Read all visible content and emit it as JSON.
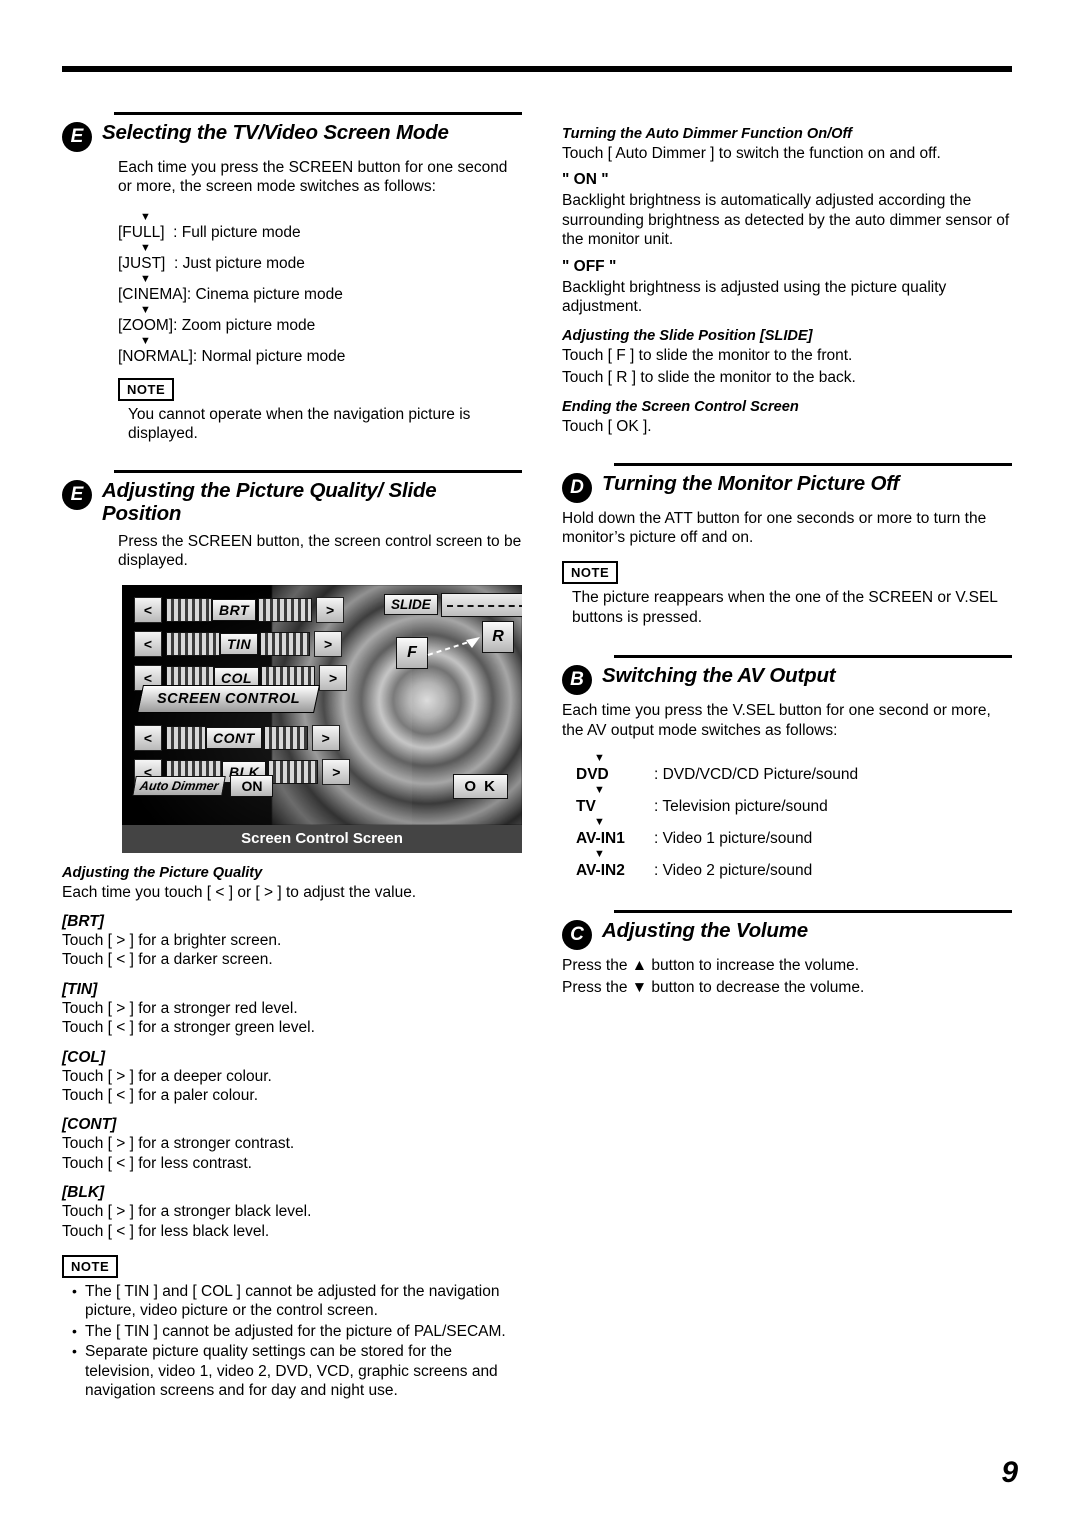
{
  "page": {
    "number": "9"
  },
  "left": {
    "sec_e1": {
      "badge": "E",
      "title": "Selecting the TV/Video Screen Mode",
      "body": "Each time you press the SCREEN button for one second or more, the screen mode switches as follows:",
      "flow": [
        "[FULL]  : Full picture mode",
        "[JUST]  : Just picture mode",
        "[CINEMA]: Cinema picture mode",
        "[ZOOM]: Zoom picture mode",
        "[NORMAL]: Normal picture mode"
      ],
      "note_label": "NOTE",
      "note_text": "You cannot operate when the navigation picture is displayed."
    },
    "sec_e2": {
      "badge": "E",
      "title": "Adjusting the Picture Quality/ Slide Position",
      "body": "Press the SCREEN button, the screen control screen to be displayed."
    },
    "figure": {
      "caption": "Screen Control Screen",
      "slide_label": "SLIDE",
      "f_button": "F",
      "r_button": "R",
      "logo": "SCREEN CONTROL",
      "auto_dimmer": "Auto Dimmer",
      "auto_dimmer_state": "ON",
      "ok": "O K",
      "rows": [
        {
          "left": "<",
          "label": "BRT",
          "right": ">"
        },
        {
          "left": "<",
          "label": "TIN",
          "right": ">"
        },
        {
          "left": "<",
          "label": "COL",
          "right": ">"
        },
        {
          "left": "<",
          "label": "CONT",
          "right": ">"
        },
        {
          "left": "<",
          "label": "BLK",
          "right": ">"
        }
      ]
    },
    "picture_quality": {
      "head": "Adjusting the Picture Quality",
      "body": "Each time you touch [ < ] or [ > ] to adjust the value.",
      "items": [
        {
          "key": "[BRT]",
          "lines": [
            "Touch [ > ] for a brighter screen.",
            "Touch [ < ] for a darker screen."
          ]
        },
        {
          "key": "[TIN]",
          "lines": [
            "Touch [ > ] for a stronger red level.",
            "Touch [ < ] for a stronger green level."
          ]
        },
        {
          "key": "[COL]",
          "lines": [
            "Touch [ > ] for a deeper colour.",
            "Touch [ < ] for a paler colour."
          ]
        },
        {
          "key": "[CONT]",
          "lines": [
            "Touch [ > ] for a stronger contrast.",
            "Touch [ < ] for less contrast."
          ]
        },
        {
          "key": "[BLK]",
          "lines": [
            "Touch [ > ] for a stronger black level.",
            "Touch [ < ] for less black level."
          ]
        }
      ],
      "note_label": "NOTE",
      "bullets": [
        "The [ TIN ] and [ COL ] cannot be adjusted for the navigation picture, video picture or the control screen.",
        "The [ TIN ] cannot be adjusted for the picture of PAL/SECAM.",
        "Separate picture quality settings can be stored for the television, video 1, video 2, DVD, VCD, graphic screens and navigation screens and for day and night use."
      ]
    }
  },
  "right": {
    "auto_dimmer": {
      "head": "Turning the Auto Dimmer Function On/Off",
      "body": "Touch [ Auto Dimmer ] to switch the function on and off.",
      "on_label": "\" ON \"",
      "on_body": "Backlight brightness is automatically adjusted according the surrounding brightness as detected by the auto dimmer sensor of the monitor unit.",
      "off_label": "\" OFF \"",
      "off_body": "Backlight brightness is adjusted using the picture quality adjustment."
    },
    "slide_position": {
      "head": "Adjusting the Slide Position [SLIDE]",
      "line1": "Touch [ F ] to slide the monitor to the front.",
      "line2": "Touch [ R ] to slide the monitor to the back."
    },
    "ending": {
      "head": "Ending the Screen Control Screen",
      "body": "Touch [ OK ]."
    },
    "sec_d": {
      "badge": "D",
      "title": "Turning the Monitor Picture Off",
      "body": "Hold down the ATT button for one seconds or more to turn the monitor’s picture off and on.",
      "note_label": "NOTE",
      "note_text": "The picture reappears when the one of the SCREEN or V.SEL buttons is pressed."
    },
    "sec_b": {
      "badge": "B",
      "title": "Switching the AV Output",
      "body": "Each time you press the V.SEL button for one second or more, the AV output mode switches as follows:",
      "items": [
        {
          "key": "DVD",
          "value": ": DVD/VCD/CD Picture/sound"
        },
        {
          "key": "TV",
          "value": ": Television picture/sound"
        },
        {
          "key": "AV-IN1",
          "value": ": Video 1 picture/sound"
        },
        {
          "key": "AV-IN2",
          "value": ": Video 2 picture/sound"
        }
      ]
    },
    "sec_c": {
      "badge": "C",
      "title": "Adjusting the Volume",
      "line1_pre": "Press the ",
      "line1_post": " button to increase the volume.",
      "line2_pre": "Press the ",
      "line2_post": " button to decrease the volume.",
      "up_glyph": "▲",
      "down_glyph": "▼"
    }
  }
}
